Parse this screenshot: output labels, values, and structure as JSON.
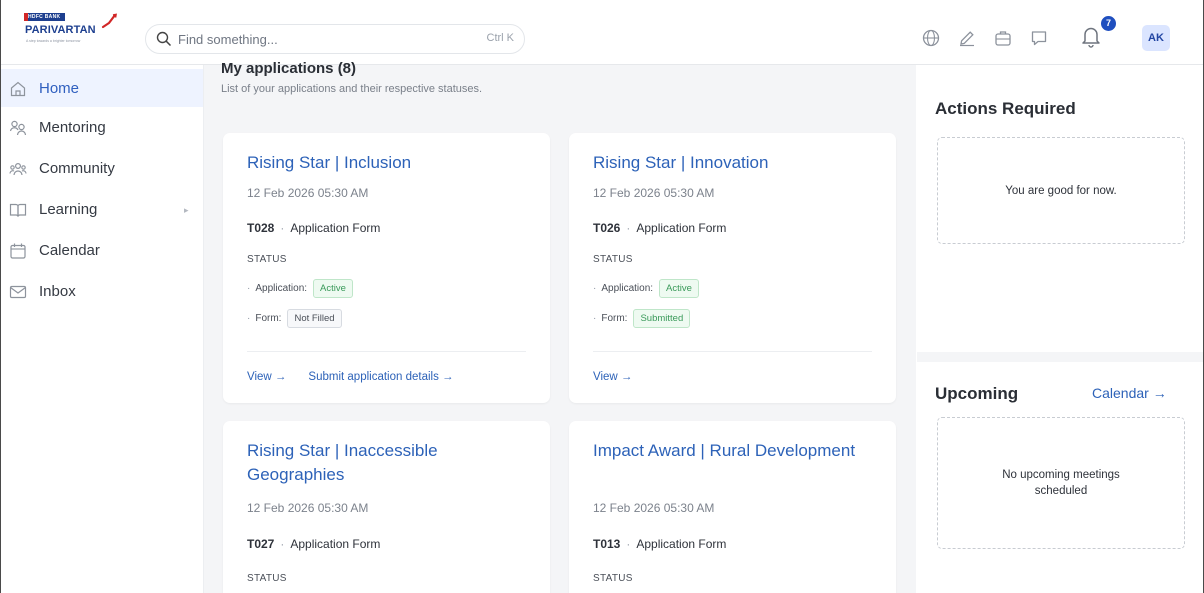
{
  "brand": {
    "bank": "HDFC BANK",
    "name": "PARIVARTAN",
    "tagline": "A step towards a brighter tomorrow",
    "colors": {
      "primary": "#1d3f8f",
      "accent": "#d12727"
    }
  },
  "search": {
    "placeholder": "Find something...",
    "shortcut": "Ctrl K",
    "icon": "search-icon"
  },
  "topbar": {
    "icons": [
      "globe-icon",
      "edit-icon",
      "briefcase-icon",
      "chat-icon",
      "bell-icon"
    ],
    "notification_count": "7",
    "avatar_initials": "AK"
  },
  "sidebar": {
    "items": [
      {
        "label": "Home",
        "icon": "home-icon",
        "active": true
      },
      {
        "label": "Mentoring",
        "icon": "mentoring-icon"
      },
      {
        "label": "Community",
        "icon": "community-icon"
      },
      {
        "label": "Learning",
        "icon": "book-icon",
        "has_submenu": true
      },
      {
        "label": "Calendar",
        "icon": "calendar-icon"
      },
      {
        "label": "Inbox",
        "icon": "mail-icon"
      }
    ]
  },
  "main": {
    "title": "My applications (8)",
    "subtitle": "List of your applications and their respective statuses.",
    "status_heading": "STATUS",
    "app_label": "Application:",
    "form_label": "Form:",
    "cards": [
      {
        "title": "Rising Star | Inclusion",
        "date": "12 Feb 2026 05:30 AM",
        "code": "T028",
        "form_type": "Application Form",
        "application_status": "Active",
        "form_status": "Not Filled",
        "links": [
          "View →",
          "Submit application details →"
        ]
      },
      {
        "title": "Rising Star | Innovation",
        "date": "12 Feb 2026 05:30 AM",
        "code": "T026",
        "form_type": "Application Form",
        "application_status": "Active",
        "form_status": "Submitted",
        "links": [
          "View →"
        ]
      },
      {
        "title": "Rising Star | Inaccessible Geographies",
        "date": "12 Feb 2026 05:30 AM",
        "code": "T027",
        "form_type": "Application Form"
      },
      {
        "title": "Impact Award | Rural Development",
        "date": "12 Feb 2026 05:30 AM",
        "code": "T013",
        "form_type": "Application Form"
      }
    ]
  },
  "right": {
    "actions_title": "Actions Required",
    "actions_empty": "You are good for now.",
    "upcoming_title": "Upcoming",
    "calendar_link": "Calendar →",
    "upcoming_empty": "No upcoming meetings scheduled"
  }
}
